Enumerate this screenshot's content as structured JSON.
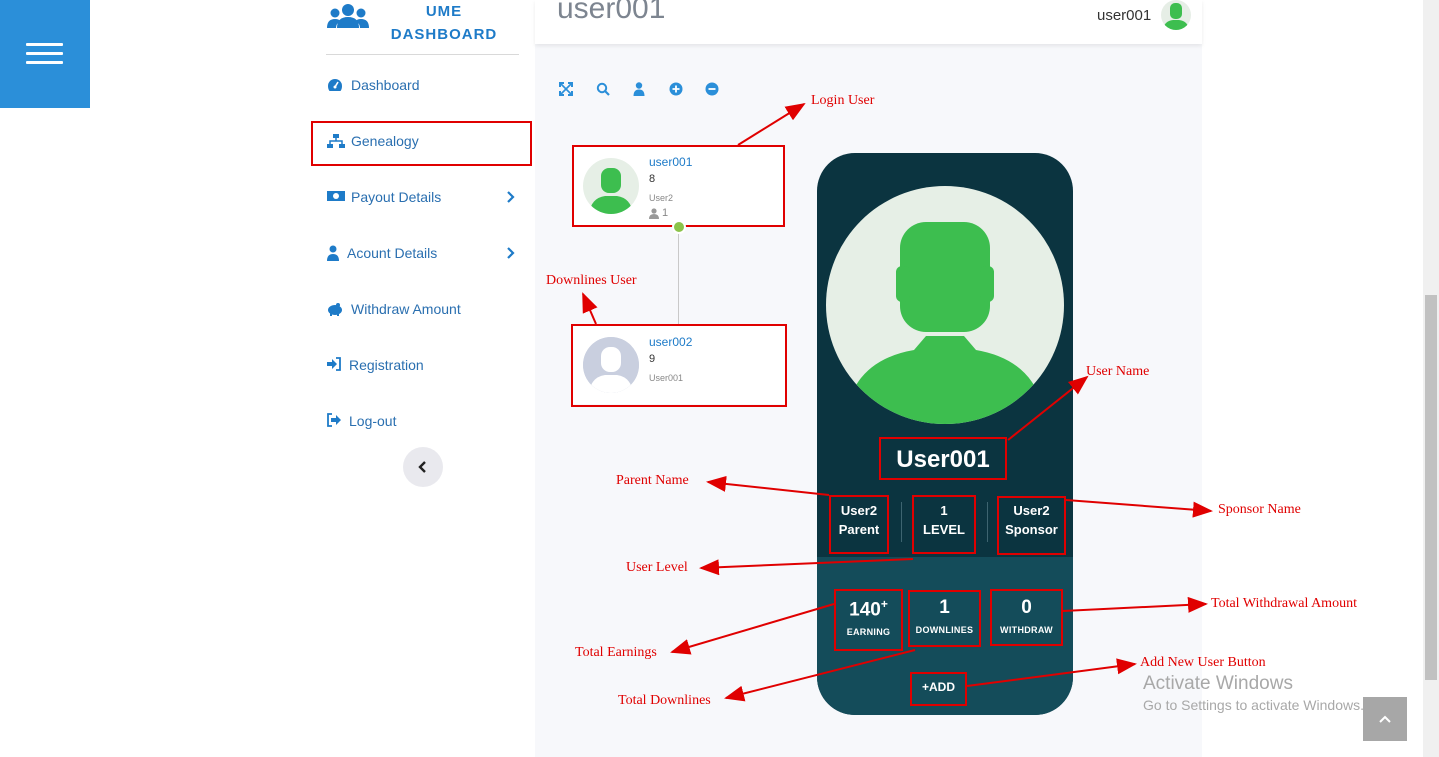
{
  "app": {
    "logo_line1": "UME",
    "logo_line2": "DASHBOARD",
    "page_title": "user001",
    "current_user": "user001"
  },
  "sidebar": {
    "items": [
      {
        "label": "Dashboard",
        "icon": "tachometer-icon"
      },
      {
        "label": "Genealogy",
        "icon": "sitemap-icon"
      },
      {
        "label": "Payout Details",
        "icon": "money-icon"
      },
      {
        "label": "Acount Details",
        "icon": "user-icon"
      },
      {
        "label": "Withdraw Amount",
        "icon": "piggy-bank-icon"
      },
      {
        "label": "Registration",
        "icon": "sign-in-icon"
      },
      {
        "label": "Log-out",
        "icon": "sign-out-icon"
      }
    ]
  },
  "toolbar": {
    "icons": [
      "expand-icon",
      "search-icon",
      "user-icon",
      "zoom-in-icon",
      "zoom-out-icon"
    ]
  },
  "tree": {
    "root": {
      "name": "user001",
      "number": "8",
      "parent": "User2",
      "count": "1"
    },
    "child": {
      "name": "user002",
      "number": "9",
      "parent": "User001"
    }
  },
  "profile": {
    "name": "User001",
    "parent_value": "User2",
    "parent_label": "Parent",
    "level_value": "1",
    "level_label": "LEVEL",
    "sponsor_value": "User2",
    "sponsor_label": "Sponsor",
    "earning_value": "140",
    "earning_sup": "+",
    "earning_label": "EARNING",
    "downlines_value": "1",
    "downlines_label": "DOWNLINES",
    "withdraw_value": "0",
    "withdraw_label": "WITHDRAW",
    "add_label": "ADD"
  },
  "annotations": {
    "login_user": "Login User",
    "downlines_user": "Downlines User",
    "user_name": "User Name",
    "parent_name": "Parent Name",
    "sponsor_name": "Sponsor Name",
    "user_level": "User Level",
    "total_withdrawal": "Total Withdrawal Amount",
    "total_earnings": "Total Earnings",
    "total_downlines": "Total Downlines",
    "add_new_user": "Add New User Button"
  },
  "watermark": {
    "line1": "Activate Windows",
    "line2": "Go to Settings to activate Windows."
  },
  "colors": {
    "brand_blue": "#2b8fd9",
    "card_dark": "#0b3440",
    "card_lower": "#144c5a",
    "avatar_green": "#3dbe4f",
    "annotation_red": "#e00000"
  }
}
